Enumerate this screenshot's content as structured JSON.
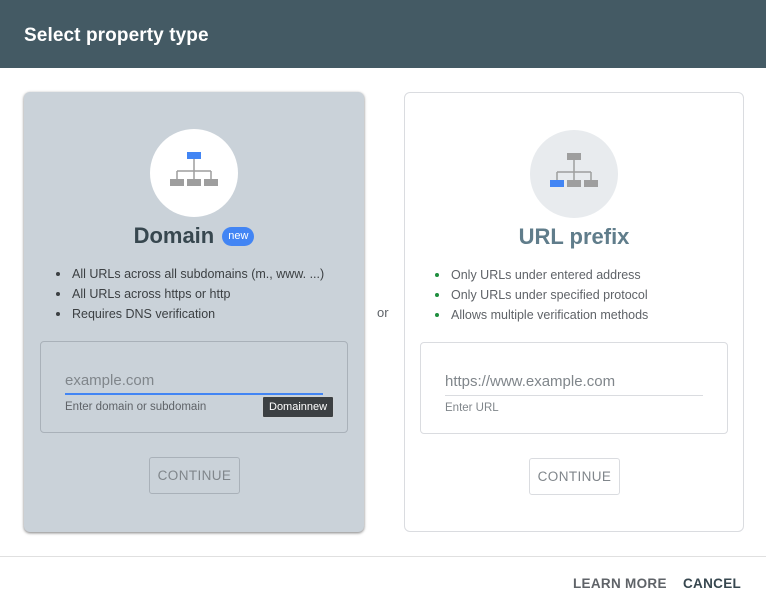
{
  "header": {
    "title": "Select property type"
  },
  "domain_card": {
    "title": "Domain",
    "badge": "new",
    "icon": "sitemap-icon",
    "features": [
      "All URLs across all subdomains (m., www. ...)",
      "All URLs across https or http",
      "Requires DNS verification"
    ],
    "input": {
      "value": "",
      "placeholder": "example.com",
      "helper": "Enter domain or subdomain"
    },
    "tooltip": "Domainnew",
    "continue_label": "CONTINUE"
  },
  "separator": "or",
  "url_card": {
    "title": "URL prefix",
    "icon": "sitemap-icon",
    "features": [
      "Only URLs under entered address",
      "Only URLs under specified protocol",
      "Allows multiple verification methods"
    ],
    "input": {
      "value": "",
      "placeholder": "https://www.example.com",
      "helper": "Enter URL"
    },
    "continue_label": "CONTINUE"
  },
  "footer": {
    "learn_more_label": "LEARN MORE",
    "cancel_label": "CANCEL"
  },
  "colors": {
    "header_bg": "#445a64",
    "accent": "#4285f4",
    "domain_card_bg": "#cad2d9",
    "icon_gray": "#9e9e9e"
  }
}
